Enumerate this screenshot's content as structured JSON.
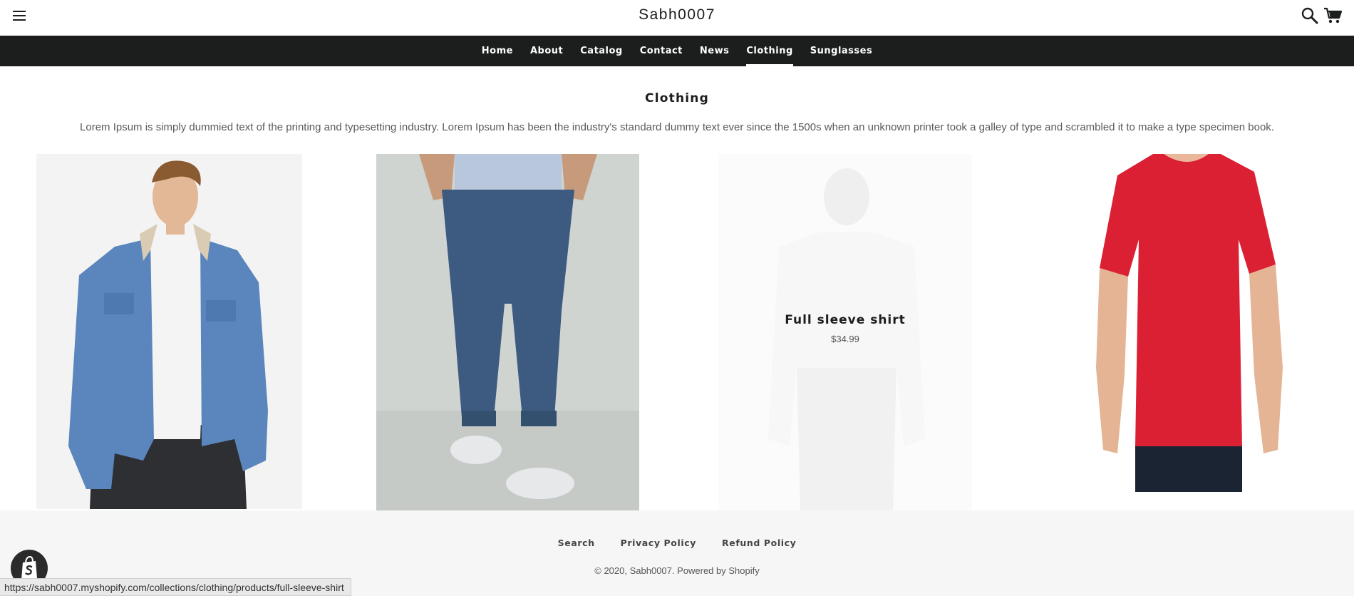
{
  "header": {
    "store_name": "Sabh0007",
    "menu_icon": "hamburger-menu-icon",
    "search_icon": "search-icon",
    "cart_icon": "cart-icon"
  },
  "nav": {
    "items": [
      {
        "label": "Home"
      },
      {
        "label": "About"
      },
      {
        "label": "Catalog"
      },
      {
        "label": "Contact"
      },
      {
        "label": "News"
      },
      {
        "label": "Clothing",
        "active": true
      },
      {
        "label": "Sunglasses"
      }
    ]
  },
  "collection": {
    "title": "Clothing",
    "description": "Lorem Ipsum is simply dummied text of the printing and typesetting industry. Lorem Ipsum has been the industry's standard dummy text ever since the 1500s when an unknown printer took a galley of type and scrambled it to make a type specimen book."
  },
  "products": [
    {
      "image": "denim-jacket-image"
    },
    {
      "image": "jeans-image"
    },
    {
      "image": "full-sleeve-shirt-image",
      "name": "Full sleeve shirt",
      "price": "$34.99",
      "hovered": true
    },
    {
      "image": "red-tshirt-image"
    }
  ],
  "footer": {
    "links": [
      {
        "label": "Search"
      },
      {
        "label": "Privacy Policy"
      },
      {
        "label": "Refund Policy"
      }
    ],
    "copyright": "© 2020, Sabh0007. Powered by Shopify"
  },
  "browser": {
    "status_url": "https://sabh0007.myshopify.com/collections/clothing/products/full-sleeve-shirt"
  },
  "colors": {
    "nav_background": "#1c1d1d",
    "footer_background": "#f6f6f6",
    "text_dark": "#1c1d1d"
  }
}
